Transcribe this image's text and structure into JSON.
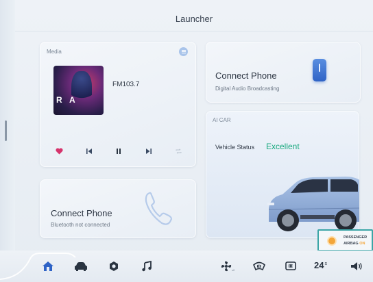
{
  "app": {
    "title": "Launcher"
  },
  "media": {
    "section_label": "Media",
    "station": "FM103.7",
    "album_letters": [
      "R",
      "A"
    ],
    "controls": [
      "heart-icon",
      "previous-icon",
      "pause-icon",
      "next-icon",
      "repeat-icon"
    ]
  },
  "dab_card": {
    "title": "Connect Phone",
    "subtitle": "Digital Audio Broadcasting"
  },
  "car_card": {
    "section_label": "AI CAR",
    "status_label": "Vehicle Status",
    "status_value": "Excellent"
  },
  "bt_card": {
    "title": "Connect Phone",
    "subtitle": "Bluetooth not connected"
  },
  "airbag": {
    "line1": "PASSENGER",
    "line2": "AIRBAG",
    "state": "ON"
  },
  "dock": {
    "items": [
      "home-icon",
      "car-icon",
      "settings-icon",
      "music-icon",
      "fan-icon",
      "front-defrost-icon",
      "rear-defrost-icon",
      "volume-icon"
    ],
    "temperature": "24",
    "temperature_unit": "s"
  },
  "colors": {
    "accent_blue": "#2f63c6",
    "status_green": "#19a97e",
    "favorite_pink": "#d6336c",
    "airbag_orange": "#f3a63a",
    "airbag_border": "#3ba5a6"
  }
}
